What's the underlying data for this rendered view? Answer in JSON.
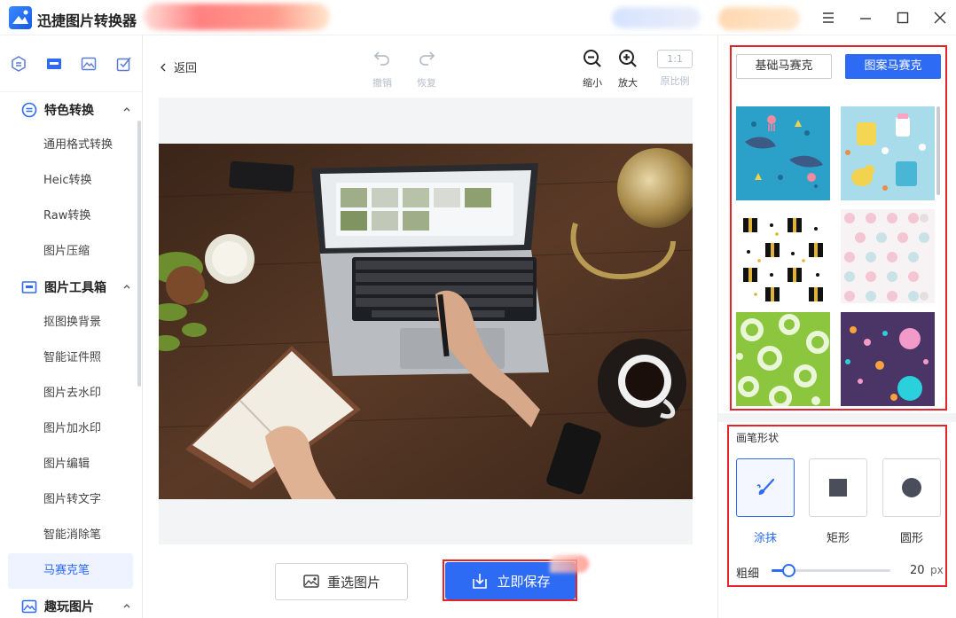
{
  "app": {
    "title": "迅捷图片转换器"
  },
  "sidebar": {
    "groups": [
      {
        "label": "特色转换",
        "items": [
          "通用格式转换",
          "Heic转换",
          "Raw转换",
          "图片压缩"
        ]
      },
      {
        "label": "图片工具箱",
        "items": [
          "抠图换背景",
          "智能证件照",
          "图片去水印",
          "图片加水印",
          "图片编辑",
          "图片转文字",
          "智能消除笔",
          "马赛克笔"
        ]
      },
      {
        "label": "趣玩图片",
        "items": []
      }
    ],
    "active_item": "马赛克笔"
  },
  "toolbar": {
    "back": "返回",
    "undo": "撤销",
    "redo": "恢复",
    "zoom_out": "缩小",
    "zoom_in": "放大",
    "original_ratio": "原比例",
    "ratio_box": "1:1"
  },
  "actions": {
    "reselect": "重选图片",
    "save": "立即保存"
  },
  "mosaic_panel": {
    "tabs": [
      "基础马赛克",
      "图案马赛克"
    ],
    "active_tab": "图案马赛克",
    "patterns": [
      "sea-creatures",
      "baby-items",
      "gift-boxes",
      "pastel-dots",
      "green-rings",
      "purple-bubbles"
    ]
  },
  "brush": {
    "section_title": "画笔形状",
    "shapes": [
      "涂抹",
      "矩形",
      "圆形"
    ],
    "active_shape": "涂抹",
    "size_label": "粗细",
    "size_value": "20",
    "size_unit": "px",
    "size_fraction": 0.15
  },
  "colors": {
    "accent": "#2d6bf4",
    "highlight": "#e3242b"
  }
}
